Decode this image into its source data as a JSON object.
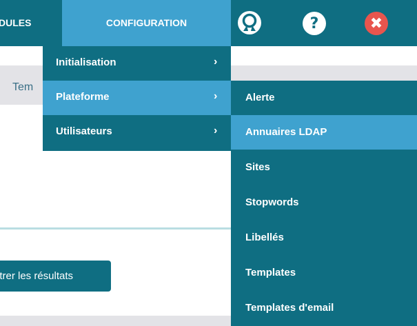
{
  "topbar": {
    "modules_label": "DULES",
    "config_label": "CONFIGURATION",
    "help_glyph": "?",
    "close_glyph": "✖",
    "icons": {
      "profile": "profile-icon",
      "help": "help-icon",
      "close": "close-icon"
    },
    "colors": {
      "bar": "#0f6e82",
      "active": "#3fa2cf",
      "close": "#e8554e"
    }
  },
  "page": {
    "tab_partial": "Tem",
    "filter_button": "ltrer les résultats"
  },
  "menu": {
    "items": [
      {
        "label": "Initialisation",
        "chevron": "›"
      },
      {
        "label": "Plateforme",
        "chevron": "›"
      },
      {
        "label": "Utilisateurs",
        "chevron": "›"
      }
    ],
    "active": "Plateforme"
  },
  "submenu": {
    "items": [
      {
        "label": "Alerte"
      },
      {
        "label": "Annuaires LDAP"
      },
      {
        "label": "Sites"
      },
      {
        "label": "Stopwords"
      },
      {
        "label": "Libellés"
      },
      {
        "label": "Templates"
      },
      {
        "label": "Templates d'email"
      }
    ],
    "active": "Annuaires LDAP"
  }
}
